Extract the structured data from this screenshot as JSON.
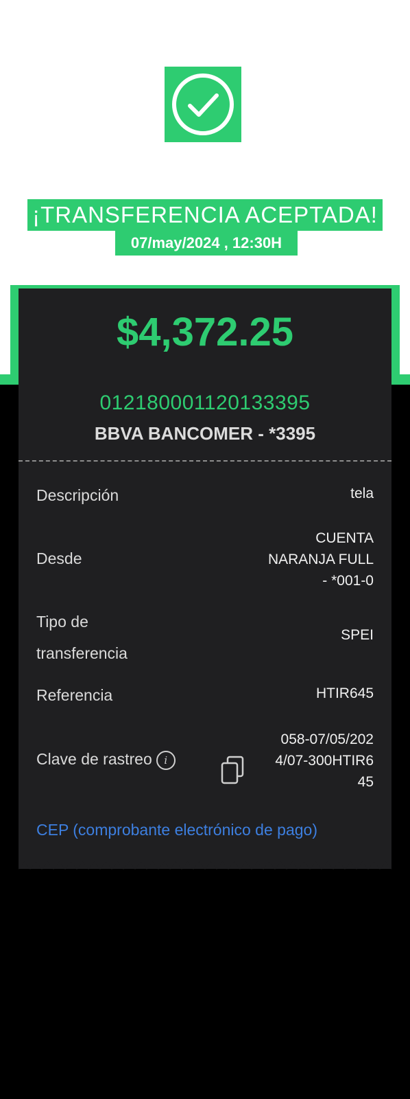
{
  "status": {
    "title": "¡TRANSFERENCIA ACEPTADA!",
    "datetime": "07/may/2024 , 12:30H"
  },
  "receipt": {
    "amount": "$4,372.25",
    "account_number": "012180001120133395",
    "bank": "BBVA BANCOMER - *3395",
    "rows": [
      {
        "label": "Descripción",
        "value": "tela"
      },
      {
        "label_line1": "Desde",
        "value_line1": "CUENTA",
        "value_line2": "NARANJA FULL",
        "value_line3": "- *001-0"
      },
      {
        "label_line1": "Tipo de",
        "label_line2": "transferencia",
        "value": "SPEI"
      },
      {
        "label": "Referencia",
        "value": "HTIR645"
      },
      {
        "label": "Clave de rastreo",
        "value_line1": "058-07/05/202",
        "value_line2": "4/07-300HTIR6",
        "value_line3": "45"
      }
    ],
    "cep_link": "CEP (comprobante electrónico de pago)"
  },
  "colors": {
    "accent": "#2ecc71",
    "card": "#1f1f21",
    "link": "#3d7fe0"
  },
  "icons": {
    "status": "check-circle-icon",
    "info": "info-icon",
    "copy": "copy-icon"
  }
}
